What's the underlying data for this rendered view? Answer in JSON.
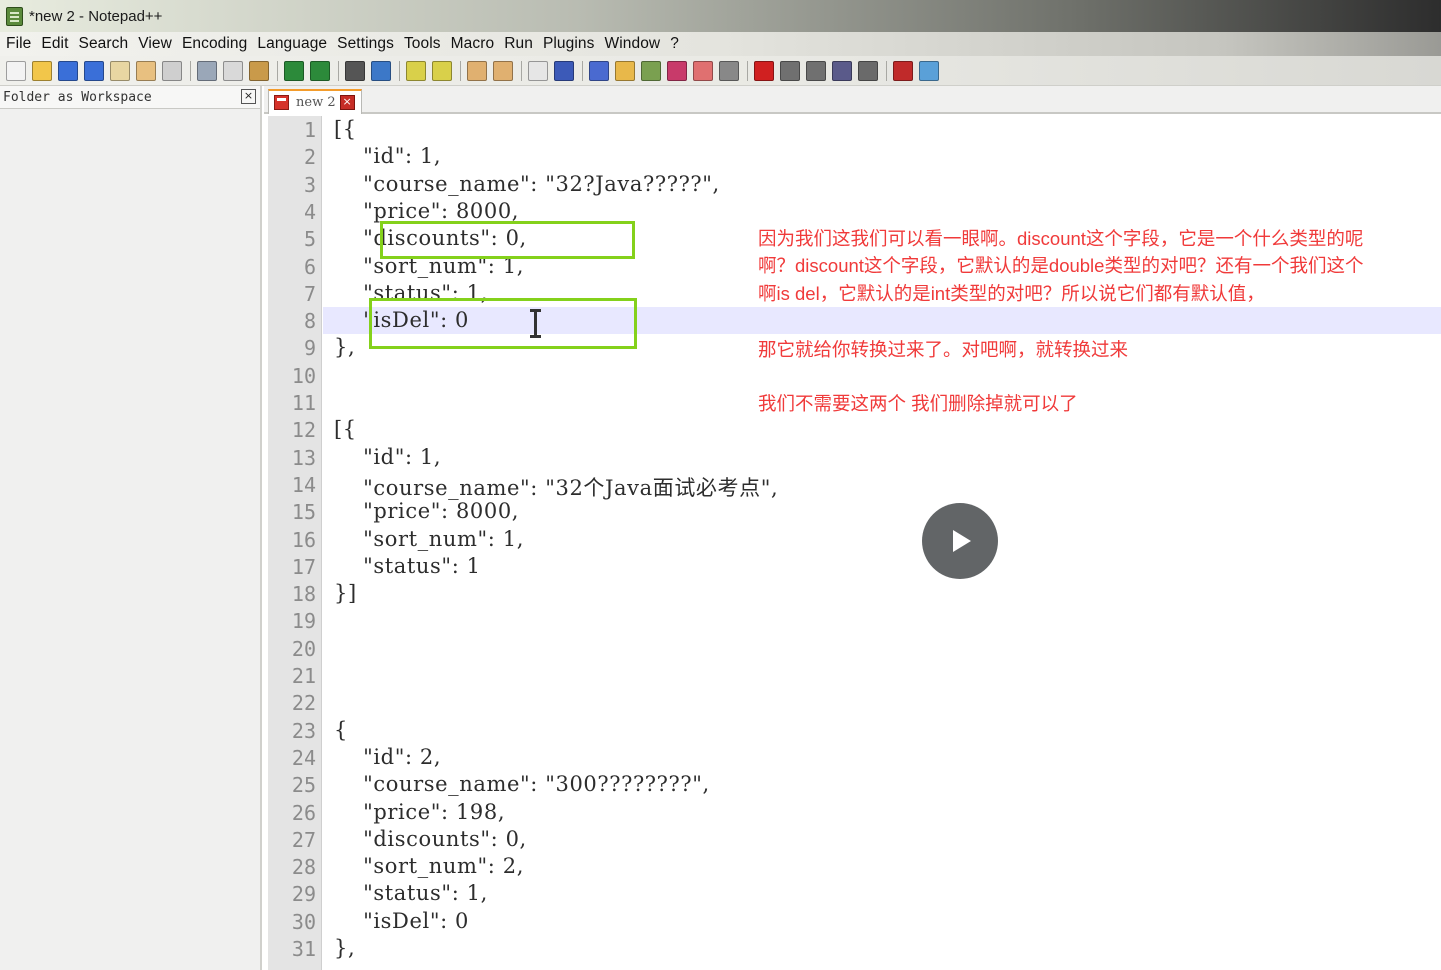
{
  "window": {
    "title": "*new 2 - Notepad++"
  },
  "menu": [
    "File",
    "Edit",
    "Search",
    "View",
    "Encoding",
    "Language",
    "Settings",
    "Tools",
    "Macro",
    "Run",
    "Plugins",
    "Window",
    "?"
  ],
  "toolbar": {
    "icons": [
      {
        "name": "new-file-icon",
        "color": "#f3f3f3"
      },
      {
        "name": "open-file-icon",
        "color": "#f2c64a"
      },
      {
        "name": "save-icon",
        "color": "#3a6fd8"
      },
      {
        "name": "save-all-icon",
        "color": "#3a6fd8"
      },
      {
        "name": "close-icon",
        "color": "#e8d6a2"
      },
      {
        "name": "close-all-icon",
        "color": "#e8c080"
      },
      {
        "name": "print-icon",
        "color": "#cfcfcf"
      },
      {
        "name": "sep"
      },
      {
        "name": "cut-icon",
        "color": "#9aa7b8"
      },
      {
        "name": "copy-icon",
        "color": "#d9d9d9"
      },
      {
        "name": "paste-icon",
        "color": "#c99a4a"
      },
      {
        "name": "sep"
      },
      {
        "name": "undo-icon",
        "color": "#2c8a3a"
      },
      {
        "name": "redo-icon",
        "color": "#2c8a3a"
      },
      {
        "name": "sep"
      },
      {
        "name": "find-icon",
        "color": "#555555"
      },
      {
        "name": "replace-icon",
        "color": "#3c78c8"
      },
      {
        "name": "sep"
      },
      {
        "name": "zoom-in-icon",
        "color": "#d9d04a"
      },
      {
        "name": "zoom-out-icon",
        "color": "#d9d04a"
      },
      {
        "name": "sep"
      },
      {
        "name": "sync-vertical-icon",
        "color": "#e0b070"
      },
      {
        "name": "sync-horizontal-icon",
        "color": "#e0b070"
      },
      {
        "name": "sep"
      },
      {
        "name": "word-wrap-icon",
        "color": "#e6e6e6"
      },
      {
        "name": "show-all-chars-icon",
        "color": "#3c5ab8"
      },
      {
        "name": "sep"
      },
      {
        "name": "indent-guide-icon",
        "color": "#4a6ad0"
      },
      {
        "name": "udl-icon",
        "color": "#e8b84a"
      },
      {
        "name": "doc-map-icon",
        "color": "#7aa050"
      },
      {
        "name": "function-list-icon",
        "color": "#c83a6a"
      },
      {
        "name": "folder-workspace-icon",
        "color": "#e07070"
      },
      {
        "name": "monitoring-icon",
        "color": "#888888"
      },
      {
        "name": "sep"
      },
      {
        "name": "record-macro-icon",
        "color": "#d02020"
      },
      {
        "name": "stop-record-icon",
        "color": "#707070"
      },
      {
        "name": "playback-icon",
        "color": "#707070"
      },
      {
        "name": "run-multiple-icon",
        "color": "#5a5a8a"
      },
      {
        "name": "save-macro-icon",
        "color": "#6a6a6a"
      },
      {
        "name": "sep"
      },
      {
        "name": "spell-check-icon",
        "color": "#c02a2a"
      },
      {
        "name": "spell-settings-icon",
        "color": "#5aa0d8"
      }
    ]
  },
  "side_panel": {
    "title": "Folder as Workspace",
    "close": "×"
  },
  "tab": {
    "label": "new 2",
    "close": "×"
  },
  "editor": {
    "current_line": 8,
    "lines": [
      "[{",
      "    \"id\": 1,",
      "    \"course_name\": \"32?Java?????\",",
      "    \"price\": 8000,",
      "    \"discounts\": 0,",
      "    \"sort_num\": 1,",
      "    \"status\": 1,",
      "    \"isDel\": 0",
      "},",
      "",
      "",
      "[{",
      "    \"id\": 1,",
      "    \"course_name\": \"32个Java面试必考点\",",
      "    \"price\": 8000,",
      "    \"sort_num\": 1,",
      "    \"status\": 1",
      "}]",
      "",
      "",
      "",
      "",
      "{",
      "    \"id\": 2,",
      "    \"course_name\": \"300????????\",",
      "    \"price\": 198,",
      "    \"discounts\": 0,",
      "    \"sort_num\": 2,",
      "    \"status\": 1,",
      "    \"isDel\": 0",
      "},"
    ]
  },
  "annotations": [
    "因为我们这我们可以看一眼啊。discount这个字段，它是一个什么类型的呢",
    "啊？discount这个字段，它默认的是double类型的对吧？还有一个我们这个",
    "啊is del，它默认的是int类型的对吧？所以说它们都有默认值，",
    "那它就给你转换过来了。对吧啊，就转换过来",
    "我们不需要这两个 我们删除掉就可以了"
  ],
  "highlight_color": "#84d11b",
  "annotation_color": "#f03a3a"
}
